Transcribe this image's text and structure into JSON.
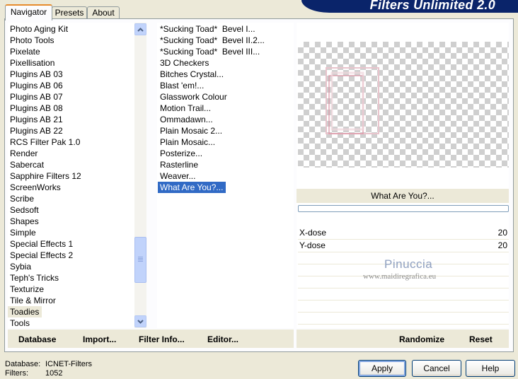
{
  "app": {
    "banner_title": "Filters Unlimited 2.0"
  },
  "tabs": [
    {
      "label": "Navigator",
      "active": true
    },
    {
      "label": "Presets",
      "active": false
    },
    {
      "label": "About",
      "active": false
    }
  ],
  "categories": {
    "items": [
      "Photo Aging Kit",
      "Photo Tools",
      "Pixelate",
      "Pixellisation",
      "Plugins AB 03",
      "Plugins AB 06",
      "Plugins AB 07",
      "Plugins AB 08",
      "Plugins AB 21",
      "Plugins AB 22",
      "RCS Filter Pak 1.0",
      "Render",
      "Sabercat",
      "Sapphire Filters 12",
      "ScreenWorks",
      "Scribe",
      "Sedsoft",
      "Shapes",
      "Simple",
      "Special Effects 1",
      "Special Effects 2",
      "Sybia",
      "Teph's Tricks",
      "Texturize",
      "Tile & Mirror",
      "Toadies",
      "Tools"
    ],
    "selected": "Toadies"
  },
  "filters": {
    "items": [
      "*Sucking Toad*  Bevel I...",
      "*Sucking Toad*  Bevel II.2...",
      "*Sucking Toad*  Bevel III...",
      "3D Checkers",
      "Bitches Crystal...",
      "Blast 'em!...",
      "Glasswork Colour",
      "Motion Trail...",
      "Ommadawn...",
      "Plain Mosaic 2...",
      "Plain Mosaic...",
      "Posterize...",
      "Rasterline",
      "Weaver...",
      "What Are You?..."
    ],
    "selected": "What Are You?..."
  },
  "selected_filter_title": "What Are You?...",
  "progress": 0,
  "params": [
    {
      "label": "X-dose",
      "value": "20"
    },
    {
      "label": "Y-dose",
      "value": "20"
    }
  ],
  "watermark": {
    "name": "Pinuccia",
    "url": "www.maidiregrafica.eu"
  },
  "toolbar": {
    "database": "Database",
    "import": "Import...",
    "filter_info": "Filter Info...",
    "editor": "Editor...",
    "randomize": "Randomize",
    "reset": "Reset"
  },
  "status": {
    "database_label": "Database:",
    "database_value": "ICNET-Filters",
    "filters_label": "Filters:",
    "filters_value": "1052"
  },
  "buttons": {
    "apply": "Apply",
    "cancel": "Cancel",
    "help": "Help"
  }
}
